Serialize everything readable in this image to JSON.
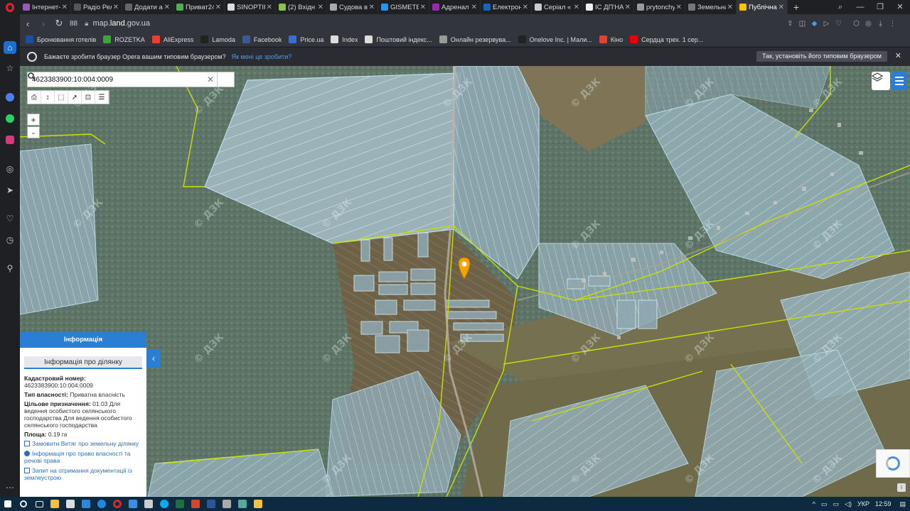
{
  "browser": {
    "tabs": [
      {
        "title": "Інтернет-",
        "color": "#9b59b6"
      },
      {
        "title": "Радіо Рел",
        "color": "#555"
      },
      {
        "title": "Додати ac",
        "color": "#666"
      },
      {
        "title": "Приват24",
        "color": "#4caf50"
      },
      {
        "title": "SINOPTIK",
        "color": "#ddd"
      },
      {
        "title": "(2) Вхідн",
        "color": "#8bc34a"
      },
      {
        "title": "Судова вл",
        "color": "#aaa"
      },
      {
        "title": "GISMETEO",
        "color": "#2196f3"
      },
      {
        "title": "Адренал",
        "color": "#9c27b0"
      },
      {
        "title": "Електрон",
        "color": "#1565c0"
      },
      {
        "title": "Серіал «",
        "color": "#ccc"
      },
      {
        "title": "ІС ДП'НА",
        "color": "#eee"
      },
      {
        "title": "prytonchy",
        "color": "#999"
      },
      {
        "title": "Земельна",
        "color": "#777"
      },
      {
        "title": "Публічна",
        "color": "#f9c300",
        "active": true
      }
    ],
    "speed_dial": "88",
    "url_prefix": "map.",
    "url_domain": "land",
    "url_suffix": ".gov.ua",
    "bookmarks": [
      {
        "label": "Бронювання готелів",
        "color": "#1c4fa1"
      },
      {
        "label": "ROZETKA",
        "color": "#3aa63a"
      },
      {
        "label": "AliExpress",
        "color": "#e8402e"
      },
      {
        "label": "Lamoda",
        "color": "#222"
      },
      {
        "label": "Facebook",
        "color": "#3b5998"
      },
      {
        "label": "Price.ua",
        "color": "#3a6ec9"
      },
      {
        "label": "Index",
        "color": "#ddd"
      },
      {
        "label": "Поштовий індекс...",
        "color": "#ddd"
      },
      {
        "label": "Онлайн резервува...",
        "color": "#999"
      },
      {
        "label": "Onelove Inc. | Мали...",
        "color": "#222"
      },
      {
        "label": "Кіно",
        "color": "#e8402e"
      },
      {
        "label": "Сердца трех. 1 сер...",
        "color": "#e00"
      }
    ],
    "default_prompt": "Бажаєте зробити браузер Opera вашим типовим браузером?",
    "default_why": "Як мені це зробити?",
    "default_yes": "Так, установіть його типовим браузером"
  },
  "map": {
    "search_value": "4623383900:10:004:0009",
    "zoom_in": "+",
    "zoom_out": "-",
    "watermark": "© ДЗК"
  },
  "info_panel": {
    "header": "Інформація",
    "section_title": "Інформація про ділянку",
    "cadastral_label": "Кадастровий номер:",
    "cadastral_value": "4623383900:10:004:0009",
    "ownership_label": "Тип власності:",
    "ownership_value": "Приватна власність",
    "purpose_label": "Цільове призначення:",
    "purpose_value": "01.03 Для ведення особистого селянського господарства Для ведення особистого селянського господарства",
    "area_label": "Площа:",
    "area_value": "0.19 га",
    "link_extract": "Замовити Витяг про земельну ділянку",
    "link_rights": "Інформація про право власності та речові права",
    "link_docs": "Запит на отримання документації із землеустрою"
  },
  "taskbar": {
    "lang": "УКР",
    "time": "12:59"
  }
}
